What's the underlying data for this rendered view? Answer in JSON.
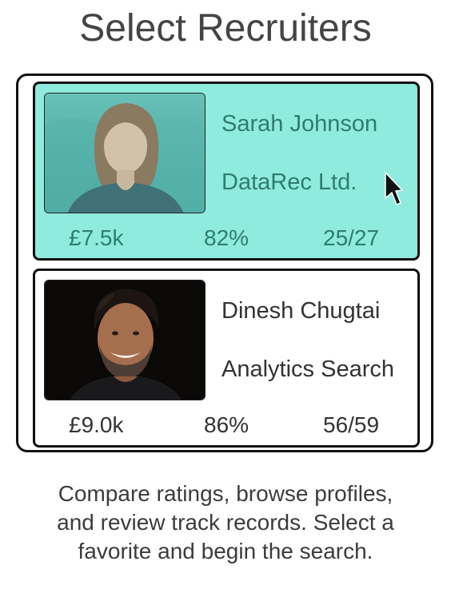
{
  "page": {
    "title": "Select Recruiters"
  },
  "recruiters": [
    {
      "name": "Sarah Johnson",
      "company": "DataRec Ltd.",
      "fee": "£7.5k",
      "rating": "82%",
      "placements": "25/27",
      "selected": true,
      "photo_icon": "woman-portrait-photo"
    },
    {
      "name": "Dinesh Chugtai",
      "company": "Analytics Search",
      "fee": "£9.0k",
      "rating": "86%",
      "placements": "56/59",
      "selected": false,
      "photo_icon": "man-portrait-photo"
    }
  ],
  "description": {
    "line1": "Compare ratings, browse profiles,",
    "line2": "and review track records. Select a",
    "line3": "favorite and begin the search."
  },
  "colors": {
    "selected_card": "#8febdd",
    "selected_text": "#2f7d70",
    "border": "#111111"
  },
  "cursor_icon": "mouse-pointer-icon"
}
